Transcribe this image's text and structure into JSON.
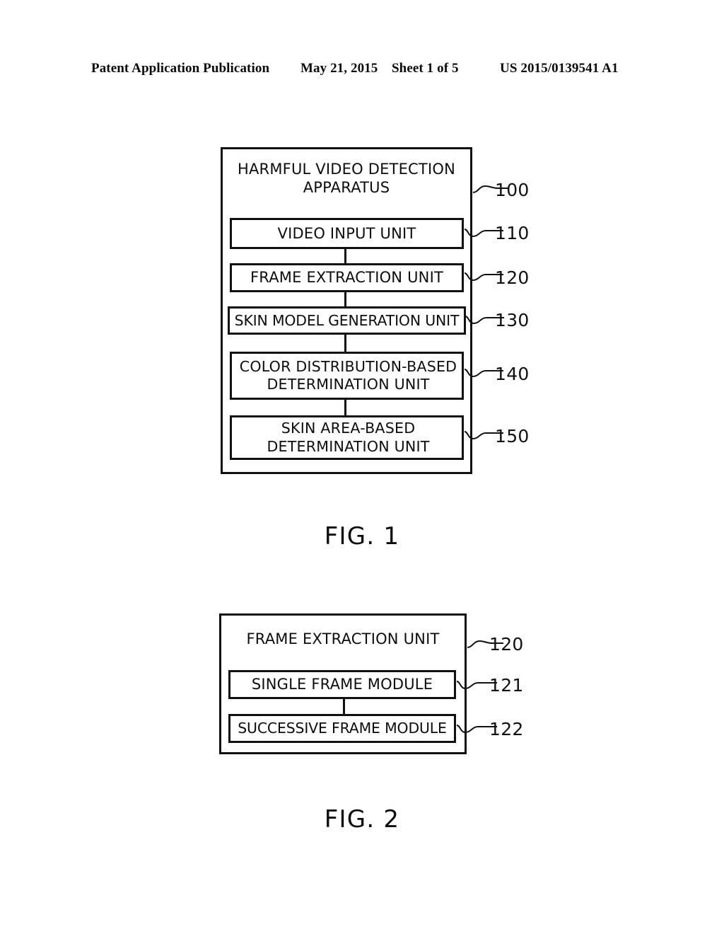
{
  "header": {
    "publication": "Patent Application Publication",
    "date": "May 21, 2015",
    "sheet": "Sheet 1 of 5",
    "document_number": "US 2015/0139541 A1"
  },
  "figures": [
    {
      "caption": "FIG. 1",
      "container": {
        "title_line1": "HARMFUL VIDEO",
        "title_line2": "DETECTION APPARATUS",
        "ref": "100"
      },
      "units": [
        {
          "line1": "VIDEO INPUT UNIT",
          "line2": "",
          "ref": "110"
        },
        {
          "line1": "FRAME EXTRACTION UNIT",
          "line2": "",
          "ref": "120"
        },
        {
          "line1": "SKIN MODEL GENERATION UNIT",
          "line2": "",
          "ref": "130"
        },
        {
          "line1": "COLOR DISTRIBUTION-BASED",
          "line2": "DETERMINATION UNIT",
          "ref": "140"
        },
        {
          "line1": "SKIN AREA-BASED",
          "line2": "DETERMINATION UNIT",
          "ref": "150"
        }
      ]
    },
    {
      "caption": "FIG. 2",
      "container": {
        "title_line1": "FRAME EXTRACTION UNIT",
        "title_line2": "",
        "ref": "120"
      },
      "units": [
        {
          "line1": "SINGLE FRAME MODULE",
          "line2": "",
          "ref": "121"
        },
        {
          "line1": "SUCCESSIVE FRAME MODULE",
          "line2": "",
          "ref": "122"
        }
      ]
    }
  ],
  "style": {
    "ink": "#111111",
    "paper": "#ffffff"
  }
}
